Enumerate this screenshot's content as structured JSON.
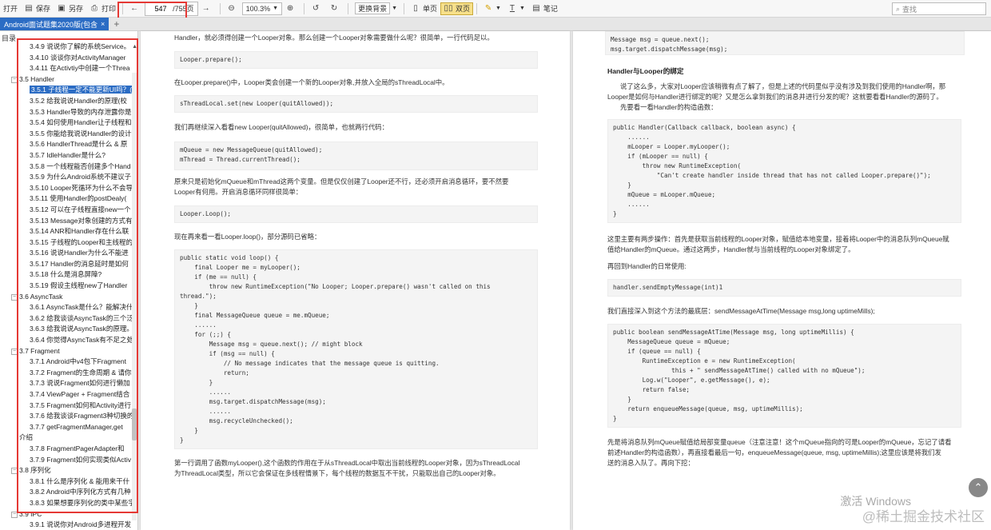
{
  "toolbar": {
    "open": "打开",
    "save": "保存",
    "save_as": "另存",
    "print": "打印",
    "page_current": "547",
    "page_total": "/755页",
    "zoom": "100.3%",
    "bg_change": "更换背景",
    "single_page": "单页",
    "double_page": "双页",
    "notes": "笔记",
    "search_placeholder": "查找"
  },
  "tab": {
    "title": "Android面试题集2020版(包含",
    "close": "×",
    "add": "+"
  },
  "sidebar": {
    "title": "目录",
    "items": [
      {
        "label": "3.4.9 说说你了解的系统Service。",
        "level": 2
      },
      {
        "label": "3.4.10 谈谈你对ActivityManager",
        "level": 2
      },
      {
        "label": "3.4.11 在Activtiy中创建一个Threa",
        "level": 2
      },
      {
        "label": "3.5 Handler",
        "level": 1,
        "expand": "⊟"
      },
      {
        "label": "3.5.1 子线程一定不能更新UI吗？(",
        "level": 2,
        "selected": true
      },
      {
        "label": "3.5.2 给我说说Handler的原理(校",
        "level": 2
      },
      {
        "label": "3.5.3 Handler导致的内存泄露你是",
        "level": 2
      },
      {
        "label": "3.5.4 如何使用Handler让子线程和",
        "level": 2
      },
      {
        "label": "3.5.5 你能给我说说Handler的设计",
        "level": 2
      },
      {
        "label": "3.5.6 HandlerThread是什么 & 原",
        "level": 2
      },
      {
        "label": "3.5.7 IdleHandler是什么?",
        "level": 2
      },
      {
        "label": "3.5.8 一个线程能否创建多个Hand",
        "level": 2
      },
      {
        "label": "3.5.9 为什么Android系统不建议子",
        "level": 2
      },
      {
        "label": "3.5.10 Looper死循环为什么不会导",
        "level": 2
      },
      {
        "label": "3.5.11 使用Handler的postDealy(",
        "level": 2
      },
      {
        "label": "3.5.12 可以在子线程直接new一个",
        "level": 2
      },
      {
        "label": "3.5.13 Message对象创建的方式有",
        "level": 2
      },
      {
        "label": "3.5.14 ANR和Handler存在什么联",
        "level": 2
      },
      {
        "label": "3.5.15 子线程的Looper和主线程的",
        "level": 2
      },
      {
        "label": "3.5.16 说说Handler为什么不能进",
        "level": 2
      },
      {
        "label": "3.5.17 Handler的消息延时是如何",
        "level": 2
      },
      {
        "label": "3.5.18 什么是消息屏障?",
        "level": 2
      },
      {
        "label": "3.5.19 假设主线程new了Handler",
        "level": 2
      },
      {
        "label": "3.6 AsyncTask",
        "level": 1,
        "expand": "⊟"
      },
      {
        "label": "3.6.1 AsyncTask是什么？能解决什",
        "level": 2
      },
      {
        "label": "3.6.2 给我谈谈AsyncTask的三个泛",
        "level": 2
      },
      {
        "label": "3.6.3 给我说说AsyncTask的原理。",
        "level": 2
      },
      {
        "label": "3.6.4 你觉得AsyncTask有不足之处",
        "level": 2
      },
      {
        "label": "3.7 Fragment",
        "level": 1,
        "expand": "⊟"
      },
      {
        "label": "3.7.1 Android中v4包下Fragment",
        "level": 2
      },
      {
        "label": "3.7.2 Fragment的生命周期 & 请你",
        "level": 2
      },
      {
        "label": "3.7.3 说说Fragment如何进行懒加",
        "level": 2
      },
      {
        "label": "3.7.4 ViewPager + Fragment结合",
        "level": 2
      },
      {
        "label": "3.7.5 Fragment如何和Activity进行",
        "level": 2
      },
      {
        "label": "3.7.6 给我谈谈Fragment3种切换的",
        "level": 2
      },
      {
        "label": "3.7.7 getFragmentManager,get",
        "level": 2
      },
      {
        "label": "介绍",
        "level": 1
      },
      {
        "label": "3.7.8 FragmentPagerAdapter和",
        "level": 2
      },
      {
        "label": "3.7.9 Fragment如何实现类似Activ",
        "level": 2
      },
      {
        "label": "3.8 序列化",
        "level": 1,
        "expand": "⊟"
      },
      {
        "label": "3.8.1 什么是序列化 & 能用来干什",
        "level": 2
      },
      {
        "label": "3.8.2 Android中序列化方式有几种",
        "level": 2
      },
      {
        "label": "3.8.3 如果想要序列化的类中某些字",
        "level": 2
      },
      {
        "label": "3.9 IPC",
        "level": 1,
        "expand": "⊟"
      },
      {
        "label": "3.9.1 说说你对Android多进程开发",
        "level": 2
      }
    ]
  },
  "left_page": {
    "p1": "Handler，就必须得创建一个Looper对象。那么创建一个Looper对象需要做什么呢？很简单，一行代码足以。",
    "c1": [
      "Looper.prepare();"
    ],
    "p2": "在Looper.prepare()中，Looper类会创建一个新的Looper对象,并放入全局的sThreadLocal中。",
    "c2": [
      "sThreadLocal.set(new Looper(quitAllowed));"
    ],
    "p3": "我们再继续深入看看new Looper(quitAllowed)，很简单，也就两行代码：",
    "c3": [
      "mQueue = new MessageQueue(quitAllowed);",
      "mThread = Thread.currentThread();"
    ],
    "p4a": "原来只是初始化mQueue和mThread这两个变量。但是仅仅创建了Looper还不行，还必须开启消息循环，要不然要",
    "p4b": "Looper有何用。开启消息循环同样很简单：",
    "c4": [
      "Looper.Loop();"
    ],
    "p5": "现在再来看一看Looper.loop()，部分源码已省略：",
    "c5": [
      "public static void loop() {",
      "    final Looper me = myLooper();",
      "    if (me == null) {",
      "        throw new RuntimeException(\"No Looper; Looper.prepare() wasn't called on this",
      "thread.\");",
      "    }",
      "    final MessageQueue queue = me.mQueue;",
      "    ......",
      "    for (;;) {",
      "        Message msg = queue.next(); // might block",
      "        if (msg == null) {",
      "            // No message indicates that the message queue is quitting.",
      "            return;",
      "        }",
      "        ......",
      "        msg.target.dispatchMessage(msg);",
      "        ......",
      "        msg.recycleUnchecked();",
      "    }",
      "}"
    ],
    "p6a": "第一行调用了函数myLooper(),这个函数的作用在于从sThreadLocal中取出当前线程的Looper对象，因为sThreadLocal",
    "p6b": "为ThreadLocal类型，所以它会保证在多线程情景下，每个线程的数据互不干扰，只能取出自己的Looper对象。"
  },
  "right_page": {
    "c0": [
      "Message msg = queue.next();",
      "msg.target.dispatchMessage(msg);"
    ],
    "h1": "Handler与Looper的绑定",
    "p1a": "说了这么多，大家对Looper应该稍微有点了解了，但是上述的代码里似乎没有涉及到我们使用的Handler啊，那",
    "p1b": "Looper是如何与Handler进行绑定的呢？又是怎么拿到我们的消息并进行分发的呢？这就要看看Handler的源码了。",
    "p1c": "先要看一看Handler的构造函数：",
    "c1": [
      "public Handler(Callback callback, boolean async) {",
      "    ......",
      "    mLooper = Looper.myLooper();",
      "    if (mLooper == null) {",
      "        throw new RuntimeException(",
      "            \"Can't create handler inside thread that has not called Looper.prepare()\");",
      "    }",
      "    mQueue = mLooper.mQueue;",
      "    ......",
      "}"
    ],
    "p2a": "这里主要有两步操作：首先是获取当前线程的Looper对象，赋值给本地变量，接着将Looper中的消息队列mQueue赋",
    "p2b": "值给Handler的mQueue。通过这两步，Handler就与当前线程的Looper对象绑定了。",
    "p3": "再回到Handler的日常使用:",
    "c2": [
      "handler.sendEmptyMessage(int)1"
    ],
    "p4": "我们直接深入到这个方法的最底层：sendMessageAtTime(Message msg,long uptimeMills);",
    "c3": [
      "public boolean sendMessageAtTime(Message msg, long uptimeMillis) {",
      "    MessageQueue queue = mQueue;",
      "    if (queue == null) {",
      "        RuntimeException e = new RuntimeException(",
      "                this + \" sendMessageAtTime() called with no mQueue\");",
      "        Log.w(\"Looper\", e.getMessage(), e);",
      "        return false;",
      "    }",
      "    return enqueueMessage(queue, msg, uptimeMillis);",
      "}"
    ],
    "p5a": "先是将消息队列mQueue赋值给局部变量queue（注意注意！这个mQueue指向的可是Looper的mQueue，忘记了请看",
    "p5b": "前述Handler的构造函数），再直接看最后一句，enqueueMessage(queue, msg, uptimeMillis);这里应该是将我们发",
    "p5c": "送的消息入队了。再向下挖："
  },
  "watermark": {
    "activate": "激活 Windows",
    "site": "@稀土掘金技术社区"
  }
}
